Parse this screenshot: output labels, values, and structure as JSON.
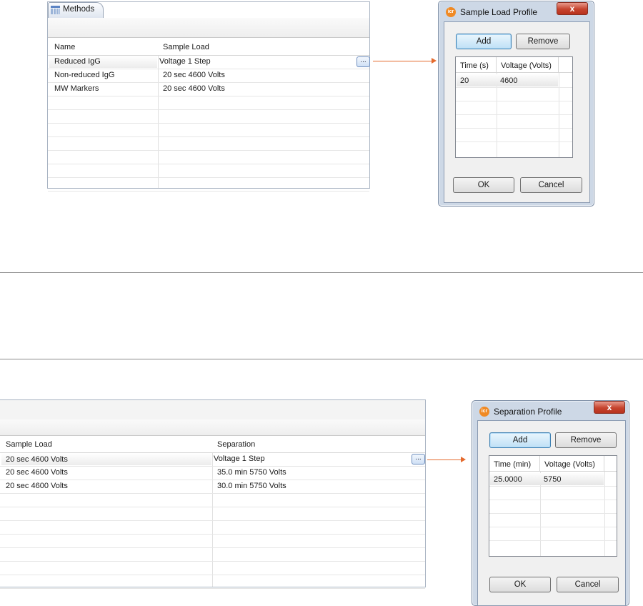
{
  "top": {
    "tab_label": "Methods",
    "columns": [
      "Name",
      "Sample Load"
    ],
    "rows": [
      {
        "name": "Reduced IgG",
        "sample_load": "Voltage 1 Step"
      },
      {
        "name": "Non-reduced IgG",
        "sample_load": "20 sec 4600 Volts"
      },
      {
        "name": "MW Markers",
        "sample_load": "20 sec 4600 Volts"
      }
    ],
    "edit_button": "..."
  },
  "top_dialog": {
    "title": "Sample Load Profile",
    "close": "x",
    "add": "Add",
    "remove": "Remove",
    "columns": [
      "Time (s)",
      "Voltage (Volts)"
    ],
    "rows": [
      {
        "c1": "20",
        "c2": "4600"
      }
    ],
    "ok": "OK",
    "cancel": "Cancel",
    "logo_text": "icr"
  },
  "bottom": {
    "columns": [
      "Sample Load",
      "Separation"
    ],
    "rows": [
      {
        "sample_load": "20 sec 4600 Volts",
        "separation": "Voltage 1 Step"
      },
      {
        "sample_load": "20 sec 4600 Volts",
        "separation": "35.0 min 5750 Volts"
      },
      {
        "sample_load": "20 sec 4600 Volts",
        "separation": "30.0 min 5750 Volts"
      }
    ],
    "edit_button": "..."
  },
  "bottom_dialog": {
    "title": "Separation Profile",
    "close": "x",
    "add": "Add",
    "remove": "Remove",
    "columns": [
      "Time (min)",
      "Voltage (Volts)"
    ],
    "rows": [
      {
        "c1": "25.0000",
        "c2": "5750"
      }
    ],
    "ok": "OK",
    "cancel": "Cancel",
    "logo_text": "icr"
  },
  "colors": {
    "arrow": "#e46a2d",
    "accent": "#3c7fb1",
    "close": "#c6442e"
  }
}
